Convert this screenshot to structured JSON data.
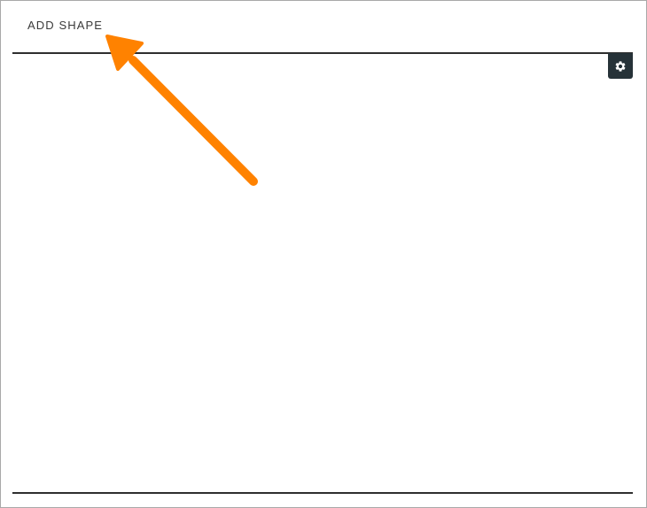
{
  "toolbar": {
    "add_shape_label": "ADD SHAPE"
  },
  "settings": {
    "icon": "gear-icon"
  },
  "colors": {
    "rule": "#2e2e2e",
    "settings_bg": "#263238",
    "annotation_arrow": "#ff8200",
    "frame_border": "#a9a9a9"
  }
}
